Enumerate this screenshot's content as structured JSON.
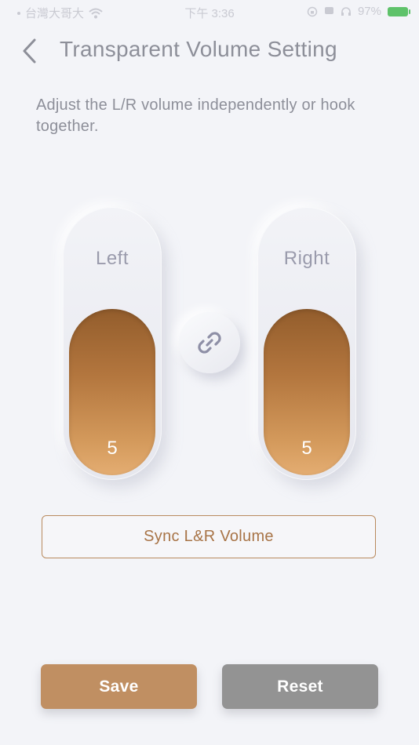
{
  "status_bar": {
    "carrier": "台灣大哥大",
    "time": "下午 3:36",
    "battery": "97%"
  },
  "header": {
    "title": "Transparent Volume Setting",
    "back_icon": "chevron-left-icon"
  },
  "description": "Adjust the L/R volume independently or hook together.",
  "sliders": {
    "left": {
      "label": "Left",
      "value": "5"
    },
    "right": {
      "label": "Right",
      "value": "5"
    }
  },
  "link_icon": "link-icon",
  "sync_button": "Sync L&R Volume",
  "actions": {
    "save": "Save",
    "reset": "Reset"
  },
  "colors": {
    "accent": "#c08f62",
    "fill_top": "#935d2c",
    "fill_bottom": "#e4ad72",
    "reset": "#939393",
    "background": "#f3f4f8"
  }
}
